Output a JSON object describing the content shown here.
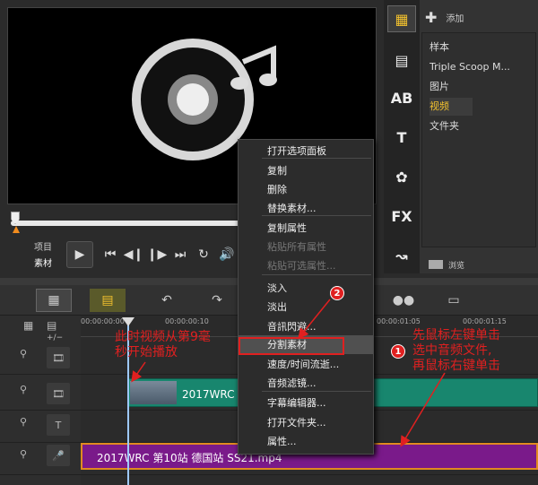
{
  "player": {
    "mode_project": "项目",
    "mode_clip": "素材",
    "icons": [
      "play-icon",
      "to-start-icon",
      "prev-frame-icon",
      "next-frame-icon",
      "to-end-icon",
      "repeat-icon",
      "volume-icon"
    ]
  },
  "library": {
    "add_label": "添加",
    "items": [
      "样本",
      "Triple Scoop M...",
      "图片",
      "视频",
      "文件夹"
    ],
    "selected": "视频",
    "browse_label": "浏览"
  },
  "sidebar": {
    "icons": [
      "media-icon",
      "instant-project-icon",
      "title-ab-icon",
      "text-t-icon",
      "graphics-icon",
      "fx-icon",
      "path-icon"
    ],
    "labels": {
      "ab": "AB",
      "t": "T",
      "fx": "FX"
    }
  },
  "ruler": {
    "ticks": [
      "00:00:00:00",
      "00:00:00:10",
      "00:00:01:05",
      "00:00:01:15"
    ]
  },
  "timeline": {
    "video_clip_label": "2017WRC 第",
    "audio_clip_label": "2017WRC 第10站 德国站 SS21.mp4",
    "zoom_label": "+/−"
  },
  "context_menu": {
    "items": [
      {
        "label": "打开选项面板",
        "disabled": false
      },
      {
        "label": "复制",
        "disabled": false
      },
      {
        "label": "删除",
        "disabled": false
      },
      {
        "label": "替换素材...",
        "disabled": false
      },
      {
        "label": "复制属性",
        "disabled": false
      },
      {
        "label": "粘贴所有属性",
        "disabled": true
      },
      {
        "label": "粘贴可选属性...",
        "disabled": true
      },
      {
        "label": "淡入",
        "disabled": false
      },
      {
        "label": "淡出",
        "disabled": false
      },
      {
        "label": "音訊閃避...",
        "disabled": false
      },
      {
        "label": "分割素材",
        "disabled": false
      },
      {
        "label": "速度/时间流逝...",
        "disabled": false
      },
      {
        "label": "音频滤镜...",
        "disabled": false
      },
      {
        "label": "字幕编辑器...",
        "disabled": false
      },
      {
        "label": "打开文件夹...",
        "disabled": false
      },
      {
        "label": "属性...",
        "disabled": false
      }
    ],
    "highlighted": "分割素材"
  },
  "annotations": {
    "left_text": [
      "此时视频从第9毫",
      "秒开始播放"
    ],
    "right_text": [
      "先鼠标左键单击",
      "选中音频文件,",
      "再鼠标右键单击"
    ],
    "badge1": "1",
    "badge2": "2"
  },
  "colors": {
    "accent": "#f2c12e",
    "annotation": "#e02020",
    "audio_clip": "#7a1a8a",
    "video_clip": "#18866e",
    "clip_border": "#e08a20"
  }
}
